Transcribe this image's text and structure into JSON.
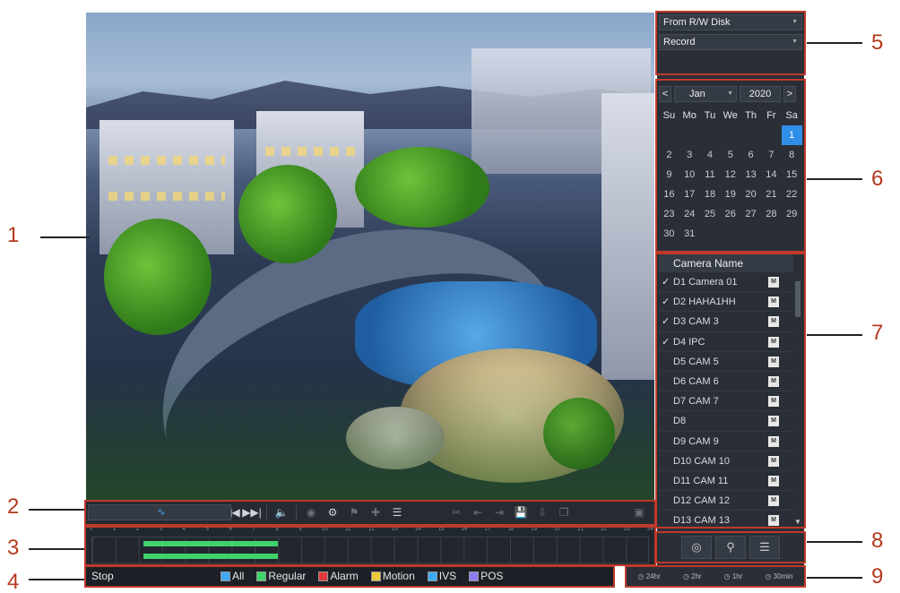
{
  "callouts": [
    "1",
    "2",
    "3",
    "4",
    "5",
    "6",
    "7",
    "8",
    "9"
  ],
  "panel": {
    "source": "From R/W Disk",
    "type": "Record"
  },
  "calendar": {
    "prev": "<",
    "next": ">",
    "month": "Jan",
    "year": "2020",
    "weekdays": [
      "Su",
      "Mo",
      "Tu",
      "We",
      "Th",
      "Fr",
      "Sa"
    ],
    "days": [
      "1",
      "2",
      "3",
      "4",
      "5",
      "6",
      "7",
      "8",
      "9",
      "10",
      "11",
      "12",
      "13",
      "14",
      "15",
      "16",
      "17",
      "18",
      "19",
      "20",
      "21",
      "22",
      "23",
      "24",
      "25",
      "26",
      "27",
      "28",
      "29",
      "30",
      "31"
    ],
    "selected_day": "1"
  },
  "cameras": {
    "header": "Camera Name",
    "items": [
      {
        "name": "D1 Camera 01",
        "checked": true
      },
      {
        "name": "D2 HAHA1HH",
        "checked": true
      },
      {
        "name": "D3 CAM 3",
        "checked": true
      },
      {
        "name": "D4 IPC",
        "checked": true
      },
      {
        "name": "D5 CAM 5",
        "checked": false
      },
      {
        "name": "D6 CAM 6",
        "checked": false
      },
      {
        "name": "D7 CAM 7",
        "checked": false
      },
      {
        "name": "D8",
        "checked": false
      },
      {
        "name": "D9 CAM 9",
        "checked": false
      },
      {
        "name": "D10 CAM 10",
        "checked": false
      },
      {
        "name": "D11 CAM 11",
        "checked": false
      },
      {
        "name": "D12 CAM 12",
        "checked": false
      },
      {
        "name": "D13 CAM 13",
        "checked": false
      }
    ],
    "m_label": "M"
  },
  "status": {
    "state": "Stop",
    "legend": [
      {
        "label": "All",
        "color": "#3fa9f5",
        "checked": true
      },
      {
        "label": "Regular",
        "color": "#3fd36b",
        "checked": true
      },
      {
        "label": "Alarm",
        "color": "#e03a3a",
        "checked": true
      },
      {
        "label": "Motion",
        "color": "#f0c93a",
        "checked": true
      },
      {
        "label": "IVS",
        "color": "#3fa9f5",
        "checked": true
      },
      {
        "label": "POS",
        "color": "#8e7cf0",
        "checked": true
      }
    ]
  },
  "speeds": [
    "24hr",
    "2hr",
    "1hr",
    "30min"
  ],
  "timeline": {
    "ticks": [
      "0",
      "1",
      "2",
      "3",
      "4",
      "5",
      "6",
      "7",
      "8",
      "9",
      "10",
      "11",
      "12",
      "13",
      "14",
      "15",
      "16",
      "17",
      "18",
      "19",
      "20",
      "21",
      "22",
      "23",
      "24"
    ],
    "record_start_hour": 2.2,
    "record_end_hour": 8.0
  }
}
